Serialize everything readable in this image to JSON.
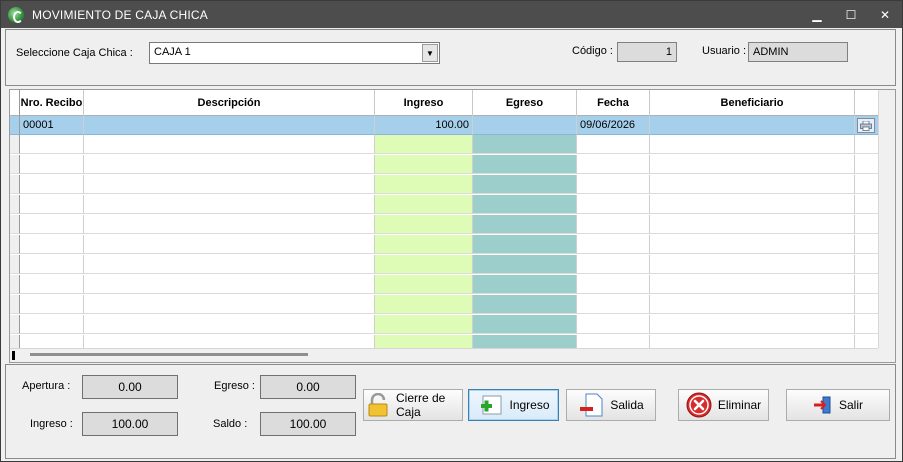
{
  "window": {
    "title": "MOVIMIENTO DE CAJA CHICA",
    "controls": {
      "minimize": "▁",
      "maximize": "☐",
      "close": "✕"
    }
  },
  "header": {
    "select_label": "Seleccione Caja Chica :",
    "select_value": "CAJA 1",
    "codigo_label": "Código :",
    "codigo_value": "1",
    "usuario_label": "Usuario :",
    "usuario_value": "ADMIN"
  },
  "grid": {
    "columns": [
      "Nro. Recibo",
      "Descripción",
      "Ingreso",
      "Egreso",
      "Fecha",
      "Beneficiario"
    ],
    "rows": [
      {
        "recibo": "00001",
        "descripcion": "",
        "ingreso": "100.00",
        "egreso": "",
        "fecha": "09/06/2026",
        "beneficiario": ""
      }
    ],
    "print_icon": "printer-icon"
  },
  "summary": {
    "apertura_label": "Apertura :",
    "apertura_value": "0.00",
    "egreso_label": "Egreso :",
    "egreso_value": "0.00",
    "ingreso_label": "Ingreso :",
    "ingreso_value": "100.00",
    "saldo_label": "Saldo :",
    "saldo_value": "100.00"
  },
  "buttons": {
    "cierre": "Cierre de Caja",
    "ingreso": "Ingreso",
    "salida": "Salida",
    "eliminar": "Eliminar",
    "salir": "Salir"
  },
  "colors": {
    "titlebar": "#4d4d4d",
    "selected_row": "#a6cfec",
    "ingreso_column": "#defcb5",
    "egreso_column": "#9ccfcc"
  }
}
